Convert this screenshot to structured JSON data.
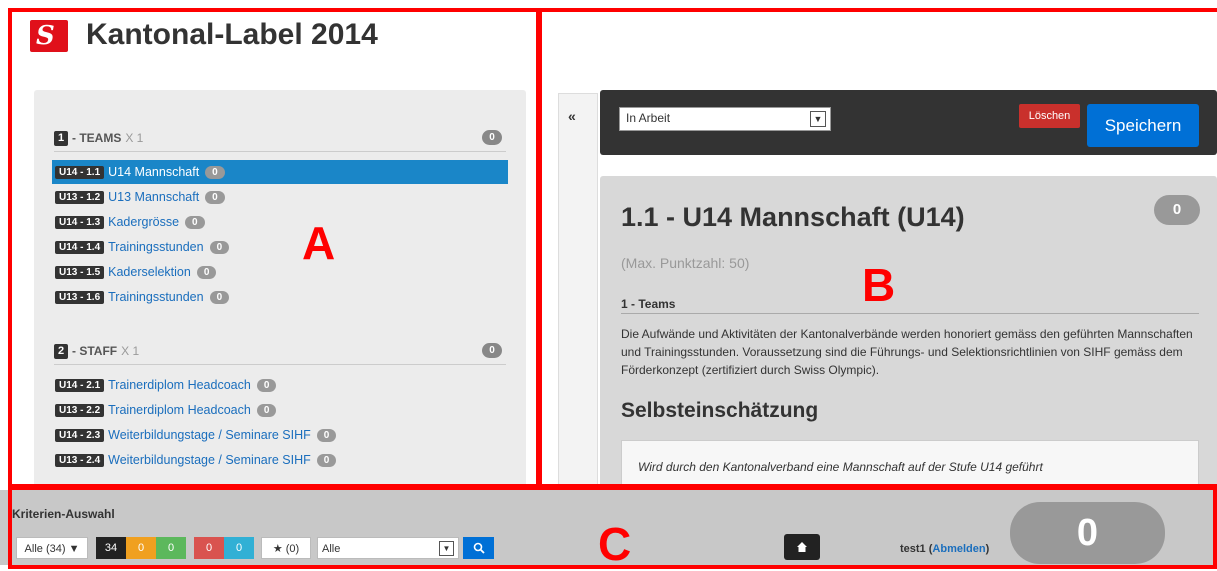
{
  "header": {
    "title": "Kantonal-Label 2014",
    "logo_glyph": "S"
  },
  "sections": [
    {
      "num": "1",
      "title": "- TEAMS",
      "mult": "X 1",
      "badge": "0",
      "items": [
        {
          "code": "U14 - 1.1",
          "label": "U14 Mannschaft",
          "count": "0",
          "active": true
        },
        {
          "code": "U13 - 1.2",
          "label": "U13 Mannschaft",
          "count": "0"
        },
        {
          "code": "U14 - 1.3",
          "label": "Kadergrösse",
          "count": "0"
        },
        {
          "code": "U14 - 1.4",
          "label": "Trainingsstunden",
          "count": "0"
        },
        {
          "code": "U13 - 1.5",
          "label": "Kaderselektion",
          "count": "0"
        },
        {
          "code": "U13 - 1.6",
          "label": "Trainingsstunden",
          "count": "0"
        }
      ]
    },
    {
      "num": "2",
      "title": "- STAFF",
      "mult": "X 1",
      "badge": "0",
      "items": [
        {
          "code": "U14 - 2.1",
          "label": "Trainerdiplom Headcoach",
          "count": "0"
        },
        {
          "code": "U13 - 2.2",
          "label": "Trainerdiplom Headcoach",
          "count": "0"
        },
        {
          "code": "U14 - 2.3",
          "label": "Weiterbildungstage / Seminare SIHF",
          "count": "0"
        },
        {
          "code": "U13 - 2.4",
          "label": "Weiterbildungstage / Seminare SIHF",
          "count": "0"
        }
      ]
    }
  ],
  "annotations": {
    "a": "A",
    "b": "B",
    "c": "C"
  },
  "toolbar": {
    "status": "In Arbeit",
    "delete_label": "Löschen",
    "save_label": "Speichern",
    "collapse_glyph": "«"
  },
  "detail": {
    "title": "1.1 - U14 Mannschaft (U14)",
    "badge": "0",
    "max_points": "(Max. Punktzahl: 50)",
    "section": "1 - Teams",
    "description": "Die Aufwände und Aktivitäten der Kantonalverbände werden honoriert gemäss den geführten Mannschaften und Trainingsstunden. Voraussetzung sind die Führungs- und Selektionsrichtlinien von SIHF gemäss dem Förderkonzept (zertifiziert durch Swiss Olympic).",
    "self_heading": "Selbsteinschätzung",
    "question": "Wird durch den Kantonalverband eine Mannschaft auf der Stufe U14 geführt"
  },
  "footer": {
    "title": "Kriterien-Auswahl",
    "filter_all": "Alle (34) ▼",
    "counts": {
      "black": "34",
      "orange": "0",
      "green": "0",
      "red": "0",
      "blue": "0"
    },
    "star": "★ (0)",
    "select_value": "Alle",
    "user": "test1",
    "logout": "Abmelden",
    "total": "0"
  }
}
